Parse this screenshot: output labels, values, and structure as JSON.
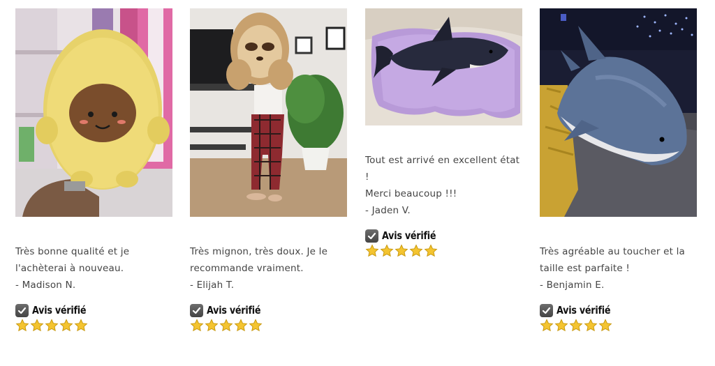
{
  "reviews": [
    {
      "image": "avocado-plush-photo",
      "text": "Très bonne qualité et je\nl'achèterai à nouveau.",
      "author": "- Madison N.",
      "verified_label": "Avis vérifié",
      "rating": 5
    },
    {
      "image": "sloth-plush-photo",
      "text": "Très mignon, très doux. Je le\nrecommande vraiment.",
      "author": "- Elijah T.",
      "verified_label": "Avis vérifié",
      "rating": 5
    },
    {
      "image": "dark-shark-plush-photo",
      "text": "Tout est arrivé en excellent état !\nMerci beaucoup !!!",
      "author": "- Jaden V.",
      "verified_label": "Avis vérifié",
      "rating": 5
    },
    {
      "image": "blue-shark-plush-photo",
      "text": "Très agréable au toucher et la\ntaille est parfaite !",
      "author": "- Benjamin E.",
      "verified_label": "Avis vérifié",
      "rating": 5
    }
  ],
  "colors": {
    "text": "#444444",
    "star": "#f4c430",
    "check_bg": "#555555"
  },
  "icons": [
    "checkbox-checked-icon",
    "star-icon"
  ]
}
